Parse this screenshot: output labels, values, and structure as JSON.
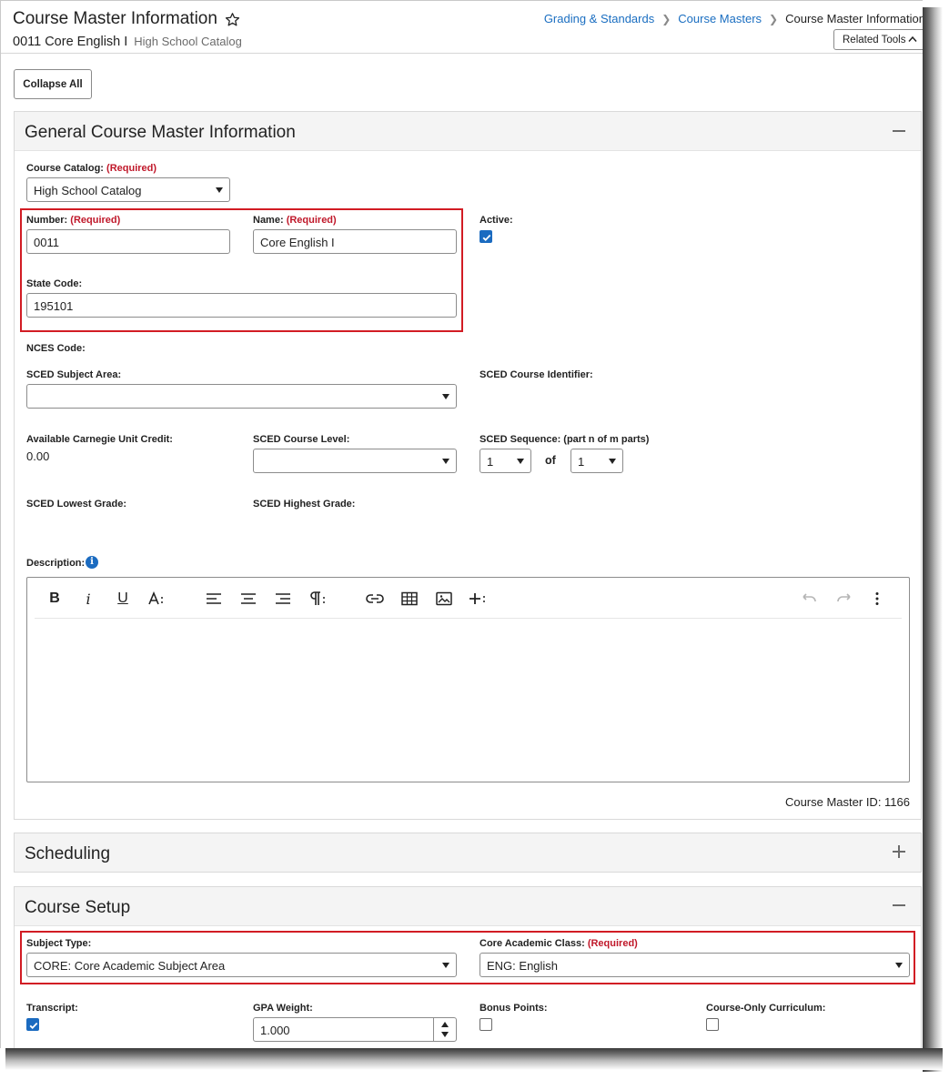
{
  "header": {
    "title": "Course Master Information",
    "subtitle_course": "0011 Core English I",
    "subtitle_catalog": "High School Catalog",
    "breadcrumb": [
      "Grading & Standards",
      "Course Masters",
      "Course Master Information"
    ],
    "related_tools_label": "Related Tools"
  },
  "toolbar": {
    "collapse_all_label": "Collapse All"
  },
  "general": {
    "title": "General Course Master Information",
    "required_text": "(Required)",
    "course_catalog_label": "Course Catalog:",
    "course_catalog_value": "High School Catalog",
    "number_label": "Number:",
    "number_value": "0011",
    "name_label": "Name:",
    "name_value": "Core English I",
    "active_label": "Active:",
    "active_checked": true,
    "state_code_label": "State Code:",
    "state_code_value": "195101",
    "nces_code_label": "NCES Code:",
    "sced_subject_area_label": "SCED Subject Area:",
    "sced_subject_area_value": "",
    "sced_course_identifier_label": "SCED Course Identifier:",
    "carnegie_label": "Available Carnegie Unit Credit:",
    "carnegie_value": "0.00",
    "sced_course_level_label": "SCED Course Level:",
    "sced_course_level_value": "",
    "sced_sequence_label": "SCED Sequence: (part n of m parts)",
    "sequence_n": "1",
    "sequence_of": "of",
    "sequence_m": "1",
    "sced_lowest_grade_label": "SCED Lowest Grade:",
    "sced_highest_grade_label": "SCED Highest Grade:",
    "description_label": "Description:",
    "course_master_id_text": "Course Master ID: 1166"
  },
  "scheduling": {
    "title": "Scheduling"
  },
  "course_setup": {
    "title": "Course Setup",
    "subject_type_label": "Subject Type:",
    "subject_type_value": "CORE: Core Academic Subject Area",
    "core_academic_class_label": "Core Academic Class:",
    "core_academic_class_value": "ENG: English",
    "transcript_label": "Transcript:",
    "transcript_checked": true,
    "gpa_weight_label": "GPA Weight:",
    "gpa_weight_value": "1.000",
    "bonus_points_label": "Bonus Points:",
    "bonus_points_checked": false,
    "course_only_curriculum_label": "Course-Only Curriculum:",
    "course_only_curriculum_checked": false
  },
  "colors": {
    "link": "#1a6ec1",
    "required": "#c0182a",
    "checkbox": "#1b6bc0",
    "highlight": "#d21c24"
  }
}
